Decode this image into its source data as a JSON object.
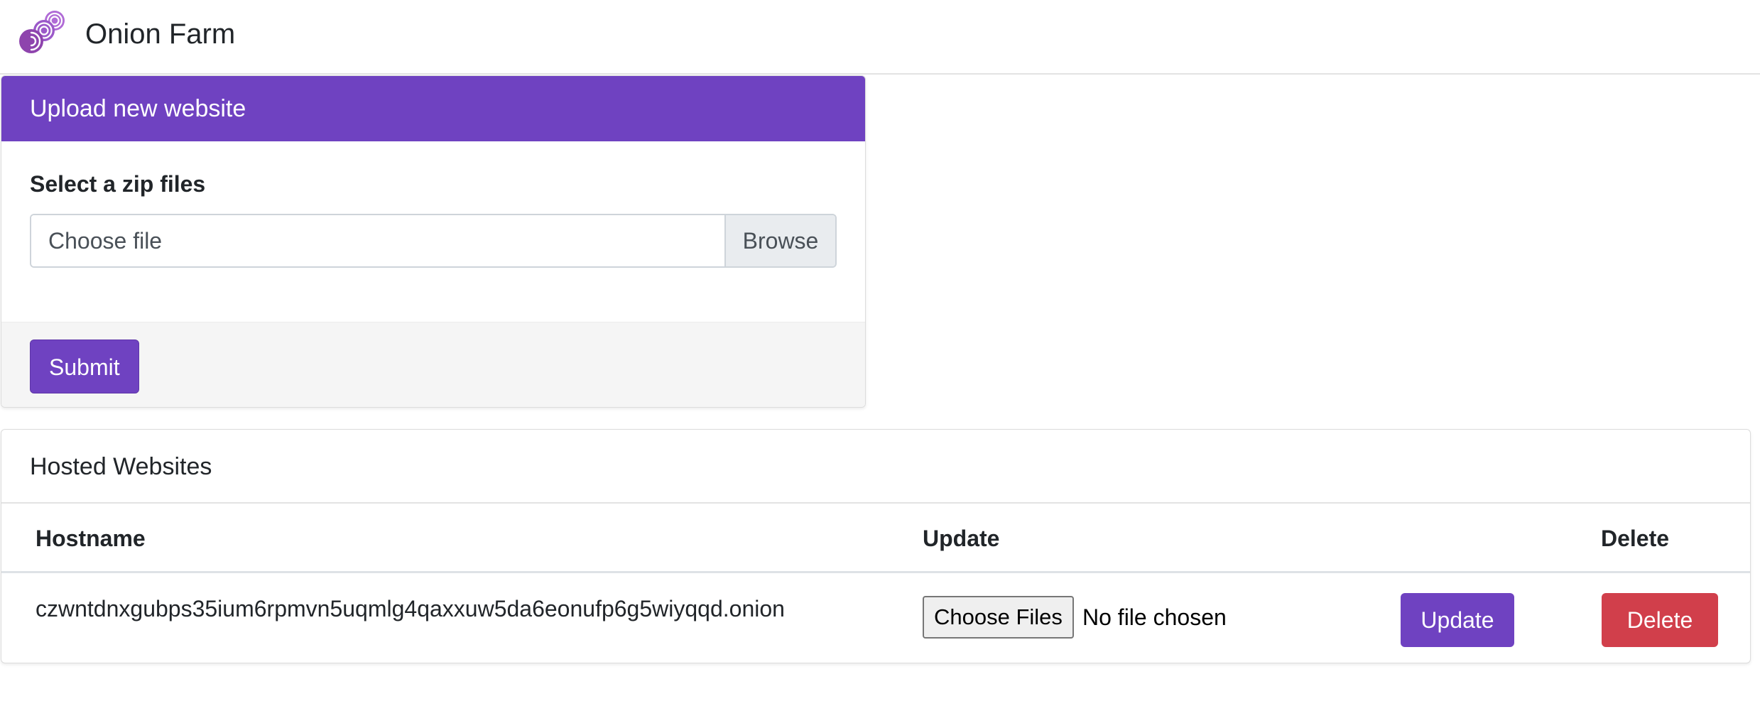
{
  "navbar": {
    "brand": "Onion Farm",
    "logo_icon": "onion-logo-icon"
  },
  "upload_card": {
    "title": "Upload new website",
    "field_label": "Select a zip files",
    "file_placeholder": "Choose file",
    "browse_label": "Browse",
    "submit_label": "Submit"
  },
  "hosted": {
    "title": "Hosted Websites",
    "columns": {
      "hostname": "Hostname",
      "update": "Update",
      "delete": "Delete"
    },
    "rows": [
      {
        "hostname": "czwntdnxgubps35ium6rpmvn5uqmlg4qaxxuw5da6eonufp6g5wiyqqd.onion",
        "choose_files_label": "Choose Files",
        "no_file_text": "No file chosen",
        "update_label": "Update",
        "delete_label": "Delete"
      }
    ]
  },
  "colors": {
    "brand_purple": "#6f42c1",
    "danger_red": "#d13f4b",
    "logo_purple": "#8e44ad"
  }
}
